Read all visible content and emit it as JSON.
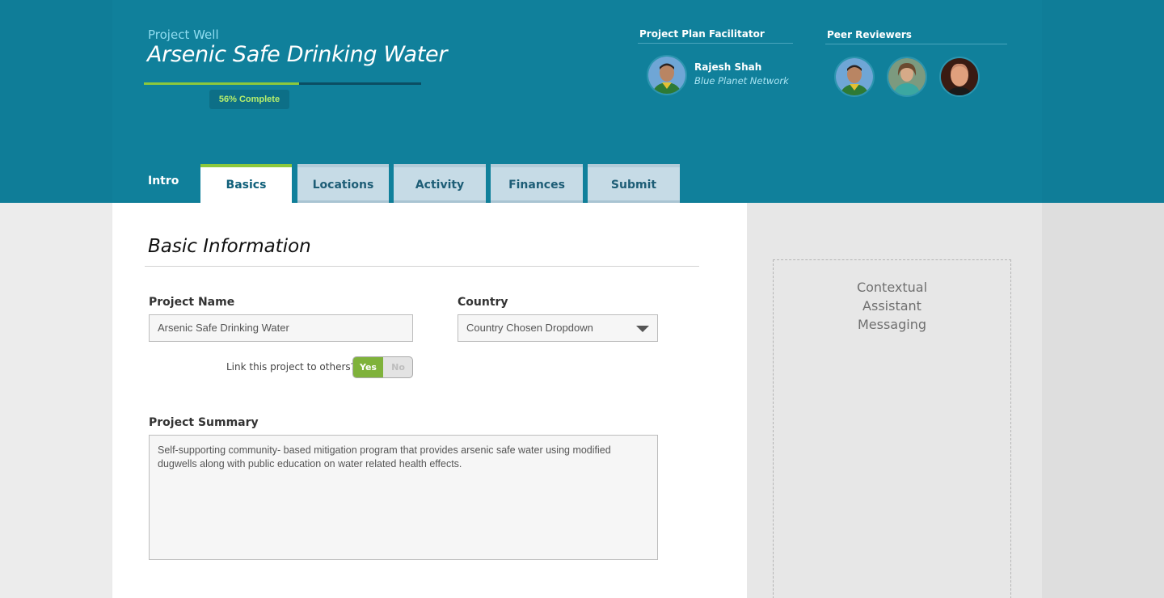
{
  "header": {
    "kicker": "Project Well",
    "title": "Arsenic Safe Drinking Water",
    "progress": {
      "percent": 56,
      "label": "56% Complete"
    },
    "facilitator": {
      "section_label": "Project Plan Facilitator",
      "name": "Rajesh Shah",
      "organization": "Blue Planet Network"
    },
    "peer_reviewers": {
      "section_label": "Peer Reviewers"
    }
  },
  "tabs": {
    "intro": "Intro",
    "items": [
      {
        "label": "Basics",
        "active": true
      },
      {
        "label": "Locations",
        "active": false
      },
      {
        "label": "Activity",
        "active": false
      },
      {
        "label": "Finances",
        "active": false
      },
      {
        "label": "Submit",
        "active": false
      }
    ]
  },
  "form": {
    "heading": "Basic Information",
    "project_name": {
      "label": "Project Name",
      "value": "Arsenic Safe Drinking Water"
    },
    "country": {
      "label": "Country",
      "value": "Country Chosen Dropdown"
    },
    "link_projects": {
      "question": "Link this project to others?",
      "yes": "Yes",
      "no": "No",
      "selected": "Yes"
    },
    "summary": {
      "label": "Project Summary",
      "line1": "Self-supporting community- based mitigation program that provides arsenic safe water using modified",
      "line2": "dugwells along with public education on water related health effects."
    }
  },
  "assistant": {
    "line1": "Contextual",
    "line2": "Assistant",
    "line3": "Messaging"
  },
  "colors": {
    "header_bg": "#10809b",
    "accent_green": "#8cc83c",
    "tab_inactive": "#c6dbe6",
    "toggle_yes": "#7fb23b"
  },
  "icons": {
    "dropdown": "chevron-down-icon"
  }
}
